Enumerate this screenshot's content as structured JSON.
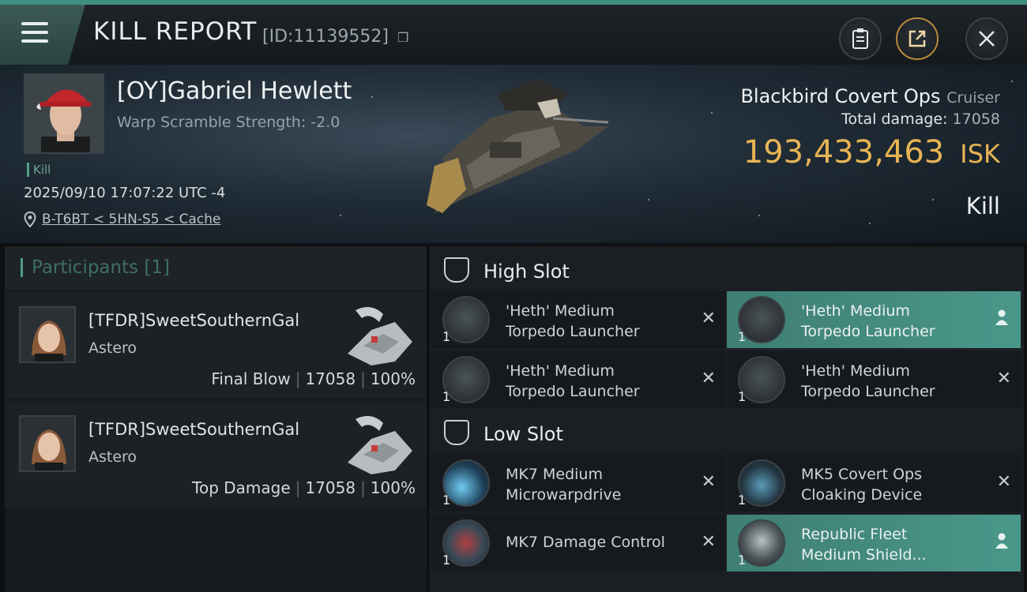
{
  "header": {
    "title": "KILL REPORT",
    "report_id": "[ID:11139552]"
  },
  "victim": {
    "name": "[OY]Gabriel Hewlett",
    "warp_scramble": "Warp Scramble Strength: -2.0",
    "tag": "Kill",
    "datetime": "2025/09/10 17:07:22 UTC -4",
    "location": "B-T6BT < 5HN-S5 < Cache"
  },
  "ship": {
    "name": "Blackbird Covert Ops",
    "class": "Cruiser",
    "total_damage_label": "Total damage:",
    "total_damage": "17058",
    "isk_value": "193,433,463",
    "isk_unit": "ISK",
    "result": "Kill"
  },
  "participants": {
    "heading": "Participants",
    "count": "[1]",
    "rows": [
      {
        "name": "[TFDR]SweetSouthernGal",
        "ship": "Astero",
        "role": "Final Blow",
        "damage": "17058",
        "percent": "100%"
      },
      {
        "name": "[TFDR]SweetSouthernGal",
        "ship": "Astero",
        "role": "Top Damage",
        "damage": "17058",
        "percent": "100%"
      }
    ]
  },
  "slots": {
    "high": {
      "label": "High Slot",
      "modules": [
        {
          "name_line1": "'Heth' Medium",
          "name_line2": "Torpedo Launcher",
          "qty": "1",
          "status": "destroyed"
        },
        {
          "name_line1": "'Heth' Medium",
          "name_line2": "Torpedo Launcher",
          "qty": "1",
          "status": "dropped"
        },
        {
          "name_line1": "'Heth' Medium",
          "name_line2": "Torpedo Launcher",
          "qty": "1",
          "status": "destroyed"
        },
        {
          "name_line1": "'Heth' Medium",
          "name_line2": "Torpedo Launcher",
          "qty": "1",
          "status": "destroyed"
        }
      ]
    },
    "low": {
      "label": "Low Slot",
      "modules": [
        {
          "name_line1": "MK7 Medium",
          "name_line2": "Microwarpdrive",
          "qty": "1",
          "status": "destroyed"
        },
        {
          "name_line1": "MK5 Covert Ops",
          "name_line2": "Cloaking Device",
          "qty": "1",
          "status": "destroyed"
        },
        {
          "name_line1": "MK7 Damage Control",
          "name_line2": "",
          "qty": "1",
          "status": "destroyed"
        },
        {
          "name_line1": "Republic Fleet",
          "name_line2": "Medium Shield...",
          "qty": "1",
          "status": "dropped"
        }
      ]
    }
  },
  "colors": {
    "accent": "#4f9f86",
    "isk": "#e8b454",
    "dropped_bg": "#4a978a"
  },
  "icons": {
    "menu": "hamburger-icon",
    "clipboard": "clipboard-icon",
    "share": "share-icon",
    "close": "close-icon",
    "location": "map-pin-icon",
    "destroyed": "x-icon",
    "dropped": "user-icon"
  }
}
